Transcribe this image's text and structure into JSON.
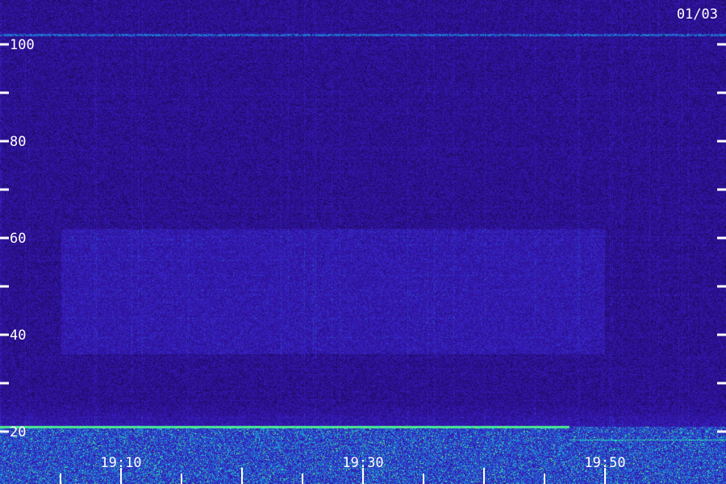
{
  "chart_data": {
    "type": "heatmap",
    "title": "01/03",
    "xlabel": "",
    "ylabel": "",
    "x_time_range": [
      "19:03",
      "19:53"
    ],
    "x_tick_labels": [
      "19:10",
      "19:30",
      "19:50"
    ],
    "y_range": [
      12,
      110
    ],
    "y_tick_labels": [
      "100",
      "80",
      "60",
      "40",
      "20"
    ],
    "y_major_ticks": [
      100,
      80,
      60,
      40,
      20
    ],
    "y_minor_ticks": [
      90,
      70,
      50,
      30
    ],
    "colormap": [
      "#12063a",
      "#2a0f8c",
      "#3a1ec4",
      "#1f6fd8",
      "#19d9c8",
      "#7dff5a"
    ],
    "background": "#1e0a52",
    "features": [
      {
        "kind": "horizontal line",
        "y": 21,
        "x_range": [
          "19:03",
          "19:47"
        ],
        "color": "#34f0a8"
      },
      {
        "kind": "horizontal line",
        "y": 102,
        "x_range": [
          "19:03",
          "19:53"
        ],
        "color": "#3f4cff"
      },
      {
        "kind": "band",
        "y_range": [
          36,
          62
        ],
        "x_range": [
          "19:05",
          "19:50"
        ],
        "color": "#3d1ec8"
      },
      {
        "kind": "noise band",
        "y_range": [
          12,
          21
        ],
        "x_range": [
          "19:03",
          "19:53"
        ],
        "color": "#19d9c8"
      }
    ]
  }
}
